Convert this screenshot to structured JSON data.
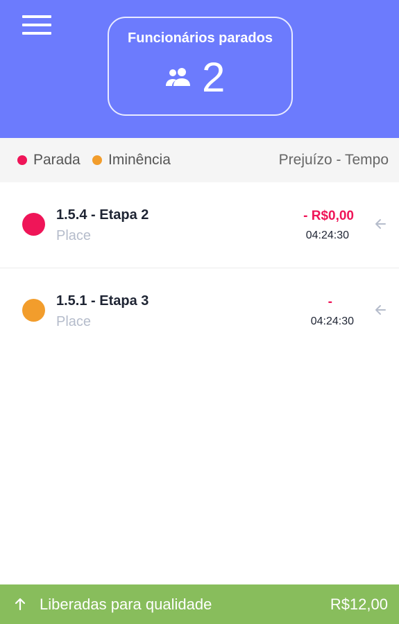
{
  "header": {
    "card_title": "Funcionários parados",
    "stopped_count": "2",
    "icons": {
      "menu": "menu-icon",
      "people": "people-icon"
    }
  },
  "legend": {
    "stopped_label": "Parada",
    "imminence_label": "Iminência",
    "columns_label": "Prejuízo - Tempo",
    "colors": {
      "stopped": "#ef1558",
      "imminence": "#f29d2c"
    }
  },
  "items": [
    {
      "title": "1.5.4 - Etapa 2",
      "subtitle": "Place",
      "value": "- R$0,00",
      "time": "04:24:30",
      "status": "stopped",
      "color": "#ef1558"
    },
    {
      "title": "1.5.1 - Etapa 3",
      "subtitle": "Place",
      "value": "-",
      "time": "04:24:30",
      "status": "imminence",
      "color": "#f29d2c"
    }
  ],
  "footer": {
    "label": "Liberadas para qualidade",
    "value": "R$12,00",
    "icon": "arrow-up-icon",
    "color": "#88bd5c"
  },
  "theme": {
    "header_color": "#6c7bfd"
  }
}
